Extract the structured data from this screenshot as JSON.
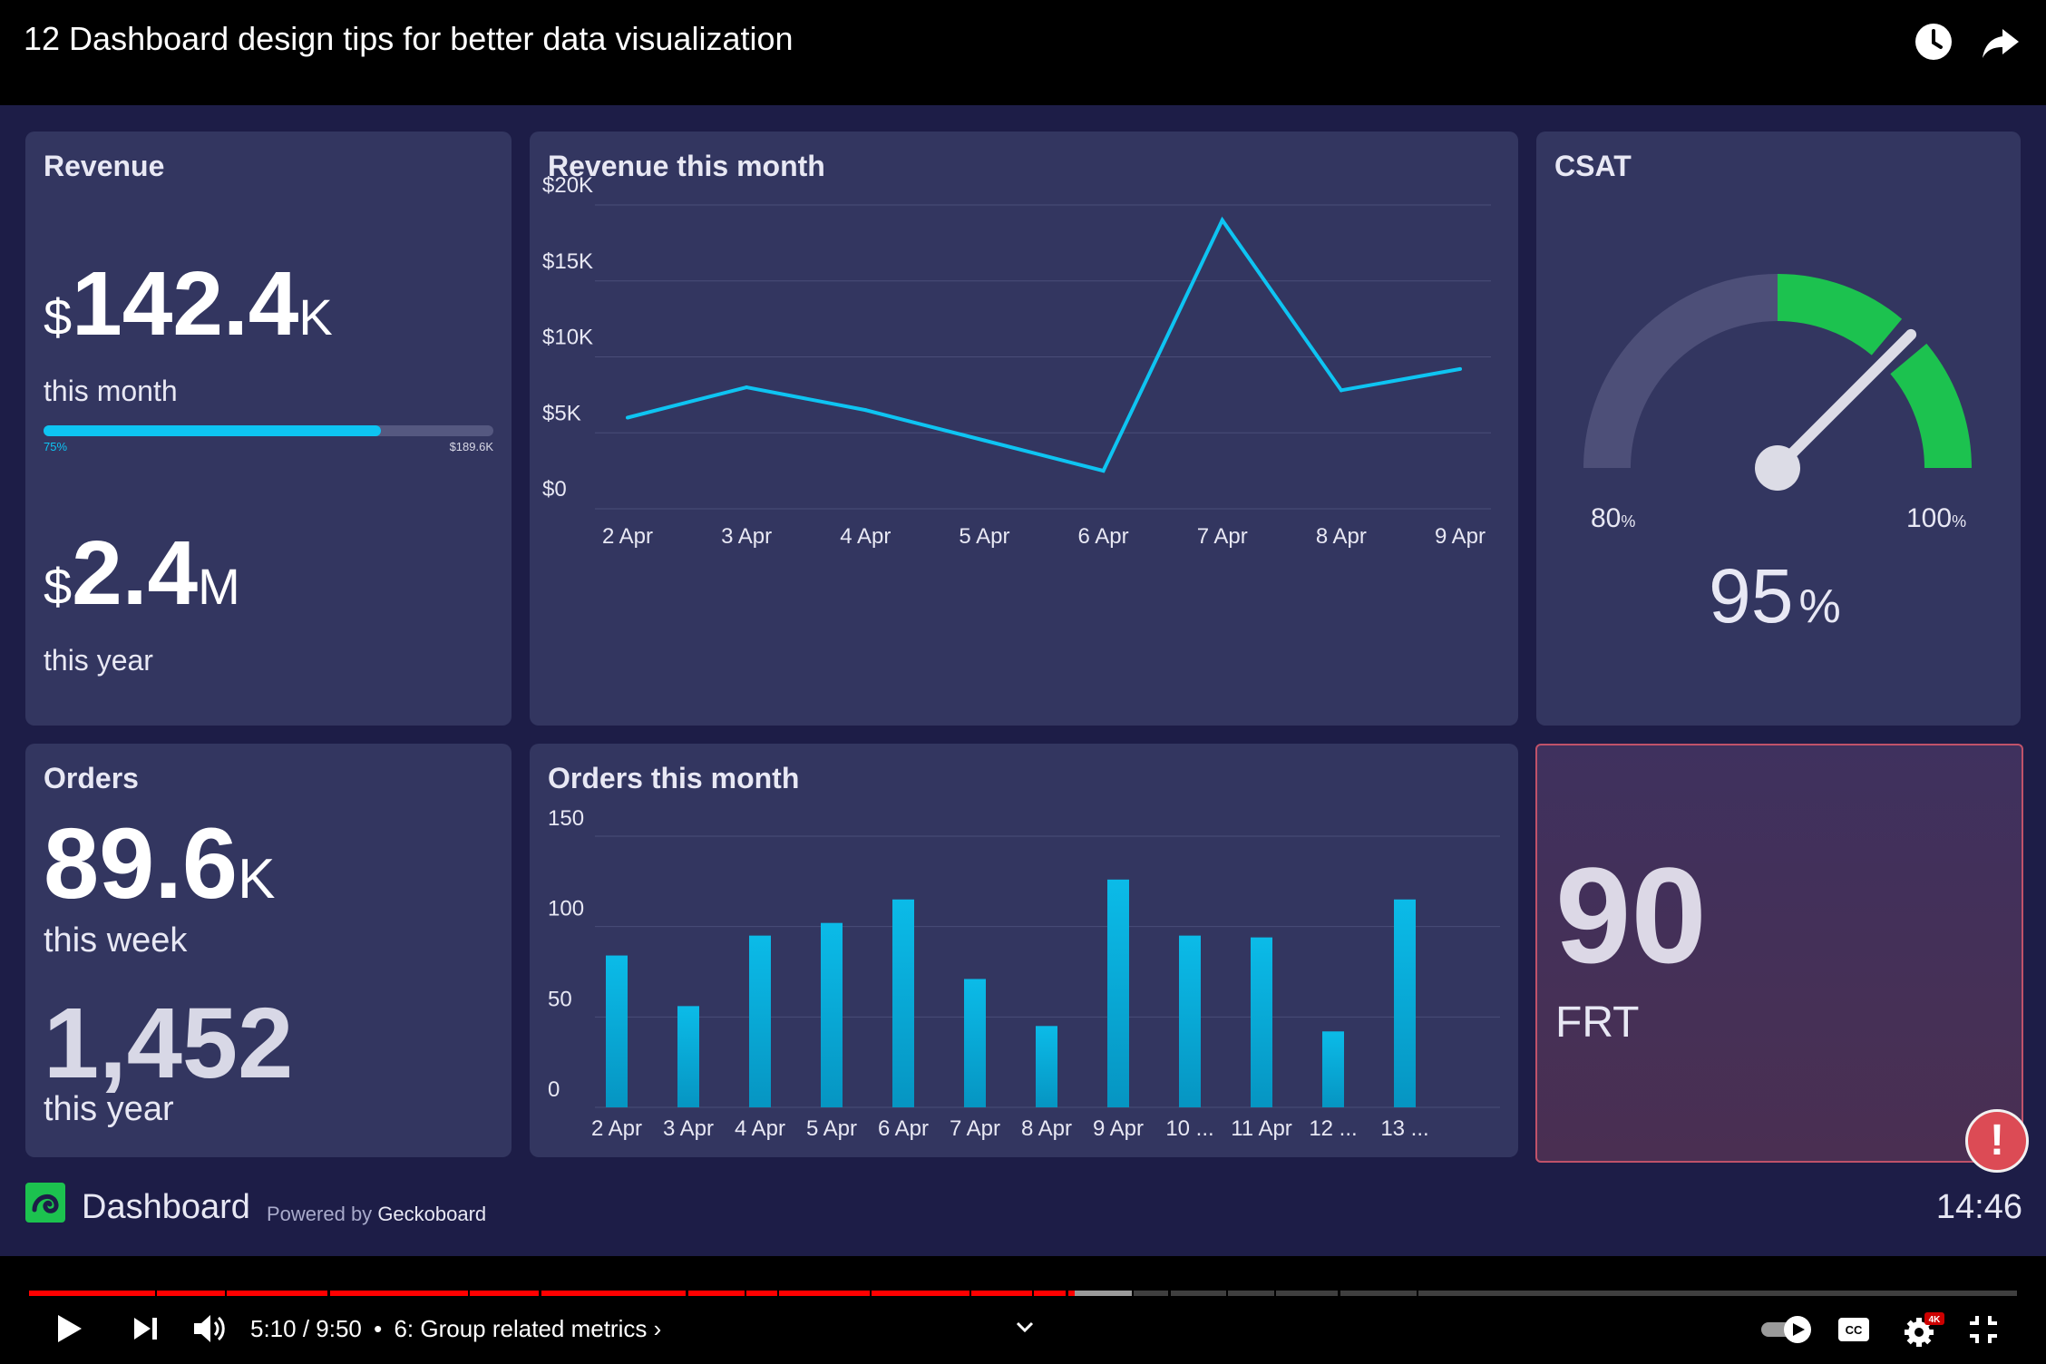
{
  "video": {
    "title": "12 Dashboard design tips for better data visualization",
    "watch_later_icon": "clock-icon",
    "share_icon": "share-arrow-icon"
  },
  "revenue": {
    "title": "Revenue",
    "month_currency": "$",
    "month_value": "142.4",
    "month_unit": "K",
    "month_label": "this month",
    "progress_fraction": 0.75,
    "progress_label": "75%",
    "target_label": "$189.6K",
    "year_currency": "$",
    "year_value": "2.4",
    "year_unit": "M",
    "year_label": "this year"
  },
  "revenue_chart_title": "Revenue this month",
  "csat": {
    "title": "CSAT",
    "min_label": "80",
    "max_label": "100",
    "unit": "%",
    "value": "95",
    "value_number": 95,
    "min": 80,
    "max": 100,
    "good_threshold": 90,
    "colors": {
      "track": "#4d4f78",
      "good": "#1cc24f",
      "needle": "#dcdce6"
    }
  },
  "orders": {
    "title": "Orders",
    "week_value": "89.6",
    "week_unit": "K",
    "week_label": "this week",
    "year_value": "1,452",
    "year_label": "this year"
  },
  "orders_chart_title": "Orders this month",
  "frt": {
    "value": "90",
    "label": "FRT",
    "alert_icon": "exclamation-icon"
  },
  "footer": {
    "brand": "Dashboard",
    "powered_prefix": "Powered by",
    "powered_name": "Geckoboard",
    "time": "14:46",
    "logo_icon": "geckoboard-logo-icon"
  },
  "player": {
    "time": "5:10 / 9:50",
    "separator": "•",
    "chapter": "6: Group related metrics",
    "chapter_chevron": "›",
    "progress_fraction": 0.526,
    "buffered_fraction": 0.555,
    "colors": {
      "played": "#ff0000",
      "buffered": "#9a9a9a",
      "unplayed": "#3f3f3f"
    },
    "icons": [
      "play-icon",
      "next-icon",
      "volume-icon",
      "chevron-down-icon",
      "autoplay-toggle-icon",
      "captions-icon",
      "settings-icon",
      "exit-fullscreen-icon"
    ],
    "settings_badge": "4K"
  },
  "chart_data": [
    {
      "type": "line",
      "title": "Revenue this month",
      "x": [
        "2 Apr",
        "3 Apr",
        "4 Apr",
        "5 Apr",
        "6 Apr",
        "7 Apr",
        "8 Apr",
        "9 Apr"
      ],
      "series": [
        {
          "values": [
            6000,
            8000,
            6500,
            4500,
            2500,
            19000,
            7800,
            9200
          ]
        }
      ],
      "yticks": [
        "$0",
        "$5K",
        "$10K",
        "$15K",
        "$20K"
      ],
      "ytick_values": [
        0,
        5000,
        10000,
        15000,
        20000
      ],
      "ylim": [
        0,
        20000
      ],
      "grid": true,
      "color": "#0ec4f2"
    },
    {
      "type": "bar",
      "title": "Orders this month",
      "categories": [
        "2 Apr",
        "3 Apr",
        "4 Apr",
        "5 Apr",
        "6 Apr",
        "7 Apr",
        "8 Apr",
        "9 Apr",
        "10 ...",
        "11 Apr",
        "12 ...",
        "13 ..."
      ],
      "values": [
        84,
        56,
        95,
        102,
        115,
        71,
        45,
        126,
        95,
        94,
        42,
        115
      ],
      "yticks": [
        "0",
        "50",
        "100",
        "150"
      ],
      "ytick_values": [
        0,
        50,
        100,
        150
      ],
      "ylim": [
        0,
        150
      ],
      "grid": true,
      "color": "#0ab4e0"
    }
  ]
}
